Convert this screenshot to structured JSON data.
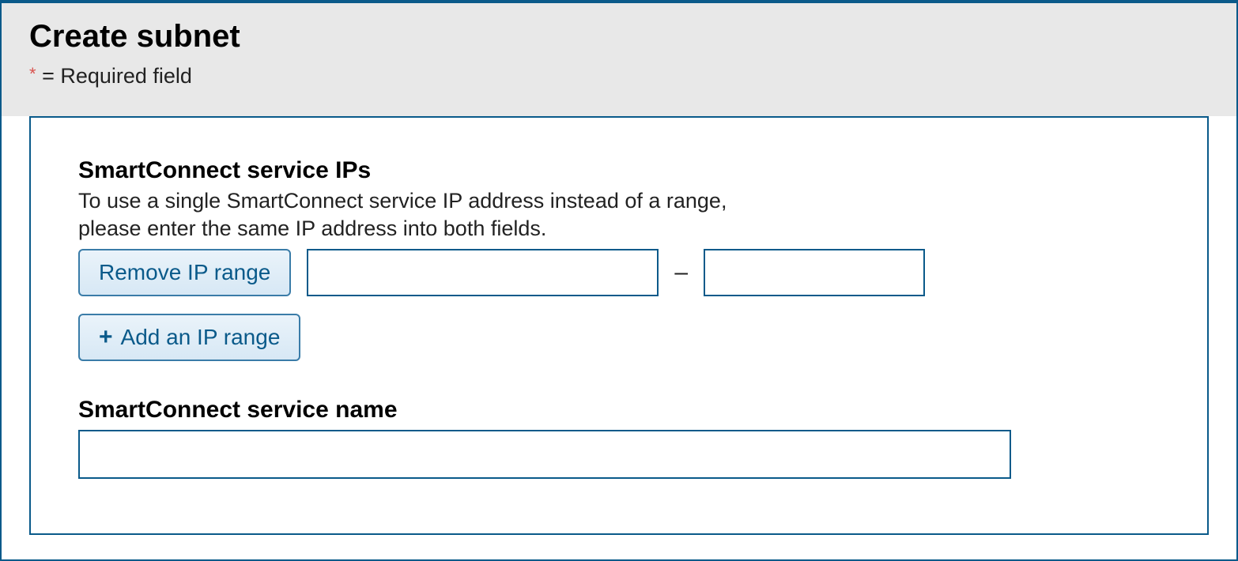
{
  "header": {
    "title": "Create subnet",
    "required_asterisk": "*",
    "required_text": " = Required field"
  },
  "smartconnect_ips": {
    "heading": "SmartConnect service IPs",
    "description_line1": "To use a single SmartConnect service IP address instead of a range,",
    "description_line2": "please enter the same IP address into both fields.",
    "remove_button": "Remove IP range",
    "ip_start": "",
    "ip_end": "",
    "dash": "–",
    "add_button": "Add an IP range"
  },
  "smartconnect_name": {
    "label": "SmartConnect service name",
    "value": ""
  }
}
